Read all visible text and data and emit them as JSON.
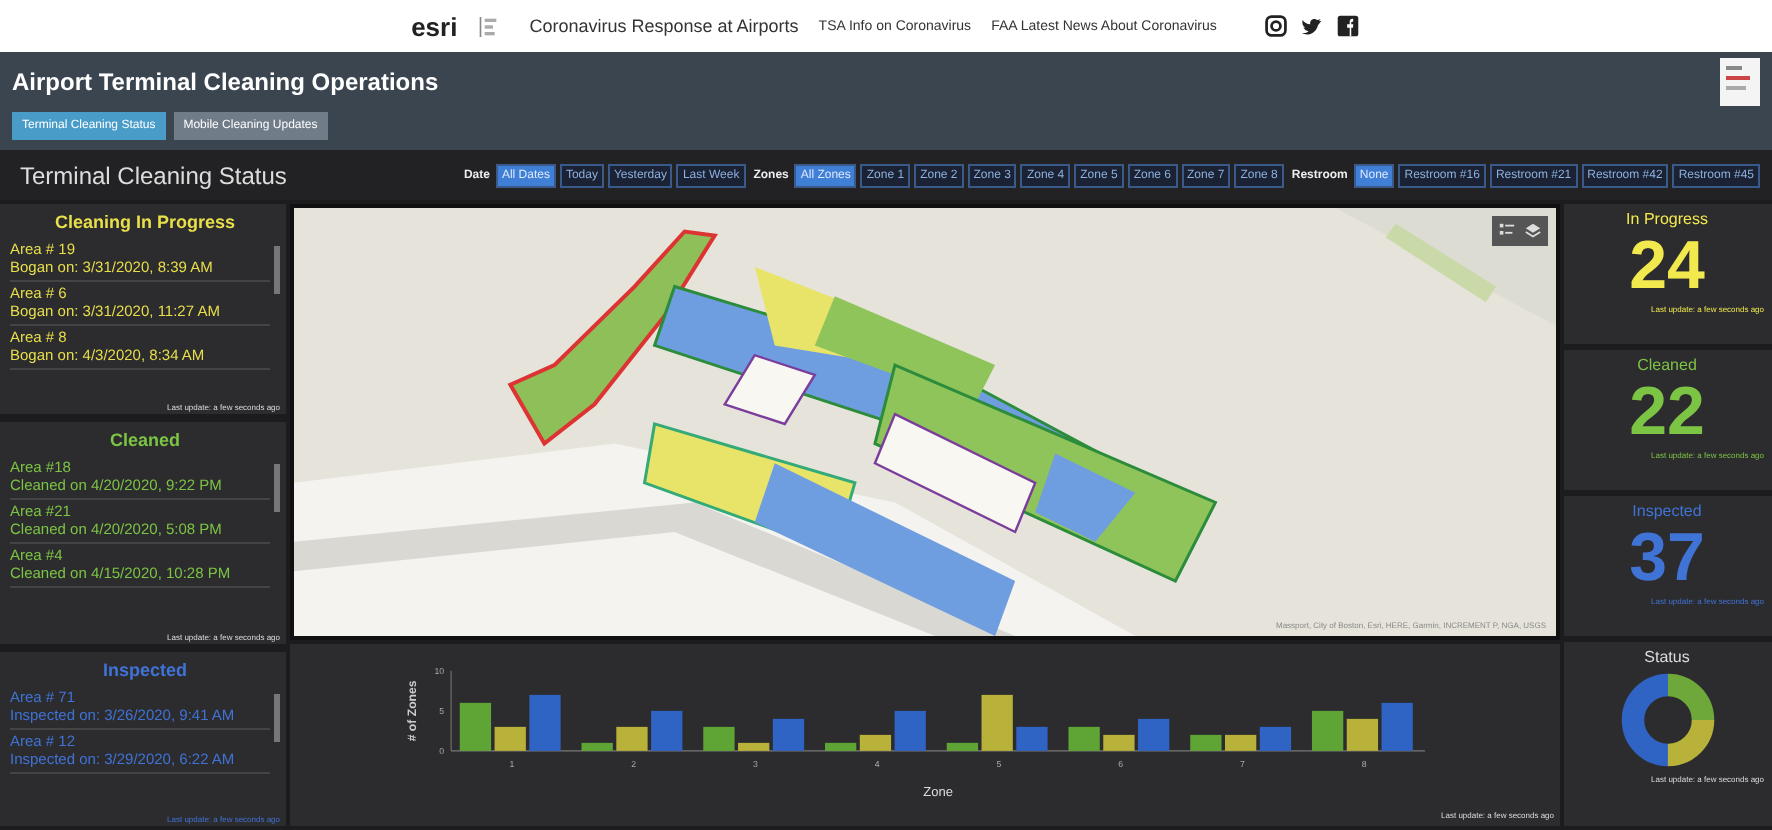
{
  "top_bar": {
    "logo": "esri",
    "links": [
      {
        "label": "Coronavirus Response at Airports"
      },
      {
        "label": "TSA Info on Coronavirus"
      },
      {
        "label": "FAA Latest News About Coronavirus"
      }
    ]
  },
  "header": {
    "title": "Airport Terminal Cleaning Operations",
    "tabs": [
      {
        "label": "Terminal Cleaning Status",
        "selected": true
      },
      {
        "label": "Mobile Cleaning Updates",
        "selected": false
      }
    ]
  },
  "filter_bar": {
    "title": "Terminal Cleaning Status",
    "groups": [
      {
        "label": "Date",
        "options": [
          {
            "label": "All Dates",
            "selected": true
          },
          {
            "label": "Today",
            "selected": false
          },
          {
            "label": "Yesterday",
            "selected": false
          },
          {
            "label": "Last Week",
            "selected": false
          }
        ]
      },
      {
        "label": "Zones",
        "options": [
          {
            "label": "All Zones",
            "selected": true
          },
          {
            "label": "Zone 1",
            "selected": false
          },
          {
            "label": "Zone 2",
            "selected": false
          },
          {
            "label": "Zone 3",
            "selected": false
          },
          {
            "label": "Zone 4",
            "selected": false
          },
          {
            "label": "Zone 5",
            "selected": false
          },
          {
            "label": "Zone 6",
            "selected": false
          },
          {
            "label": "Zone 7",
            "selected": false
          },
          {
            "label": "Zone 8",
            "selected": false
          }
        ]
      },
      {
        "label": "Restroom",
        "options": [
          {
            "label": "None",
            "selected": true
          },
          {
            "label": "Restroom #16",
            "selected": false
          },
          {
            "label": "Restroom #21",
            "selected": false
          },
          {
            "label": "Restroom #42",
            "selected": false
          },
          {
            "label": "Restroom #45",
            "selected": false
          }
        ]
      }
    ]
  },
  "lists": [
    {
      "title": "Cleaning In Progress",
      "color": "#e8df4a",
      "items": [
        {
          "title": "Area # 19",
          "detail": "Bogan on: 3/31/2020, 8:39 AM"
        },
        {
          "title": "Area # 6",
          "detail": "Bogan on: 3/31/2020, 11:27 AM"
        },
        {
          "title": "Area # 8",
          "detail": "Bogan on: 4/3/2020, 8:34 AM"
        }
      ],
      "footer": "Last update: a few seconds ago"
    },
    {
      "title": "Cleaned",
      "color": "#7cc444",
      "items": [
        {
          "title": "Area #18",
          "detail": "Cleaned on 4/20/2020, 9:22 PM"
        },
        {
          "title": "Area #21",
          "detail": "Cleaned on 4/20/2020, 5:08 PM"
        },
        {
          "title": "Area #4",
          "detail": "Cleaned on 4/15/2020, 10:28 PM"
        }
      ],
      "footer": "Last update: a few seconds ago"
    },
    {
      "title": "Inspected",
      "color": "#3f73d6",
      "items": [
        {
          "title": "Area # 71",
          "detail": "Inspected on: 3/26/2020, 9:41 AM"
        },
        {
          "title": "Area # 12",
          "detail": "Inspected on: 3/29/2020, 6:22 AM"
        }
      ],
      "footer": "Last update: a few seconds ago"
    }
  ],
  "map": {
    "attribution": "Massport, City of Boston, Esri, HERE, Garmin, INCREMENT P, NGA, USGS"
  },
  "chart": {
    "chart_data": {
      "type": "bar",
      "xlabel": "Zone",
      "ylabel": "# of Zones",
      "categories": [
        "1",
        "2",
        "3",
        "4",
        "5",
        "6",
        "7",
        "8"
      ],
      "series": [
        {
          "color": "#5fa535",
          "values": [
            6,
            1,
            3,
            1,
            1,
            3,
            2,
            5
          ]
        },
        {
          "color": "#b8b13a",
          "values": [
            3,
            3,
            1,
            2,
            7,
            2,
            2,
            4
          ]
        },
        {
          "color": "#2f63c4",
          "values": [
            7,
            5,
            4,
            5,
            3,
            4,
            3,
            6
          ]
        }
      ],
      "ylim": [
        0,
        10
      ],
      "yticks": [
        0,
        5,
        10
      ]
    },
    "footer": "Last update: a few seconds ago"
  },
  "stats": [
    {
      "title": "In Progress",
      "value": "24",
      "color": "#f2e94e",
      "footer": "Last update: a few seconds ago"
    },
    {
      "title": "Cleaned",
      "value": "22",
      "color": "#7cc444",
      "footer": "Last update: a few seconds ago"
    },
    {
      "title": "Inspected",
      "value": "37",
      "color": "#3f73d6",
      "footer": "Last update: a few seconds ago"
    }
  ],
  "status": {
    "title": "Status",
    "footer": "Last update: a few seconds ago"
  }
}
